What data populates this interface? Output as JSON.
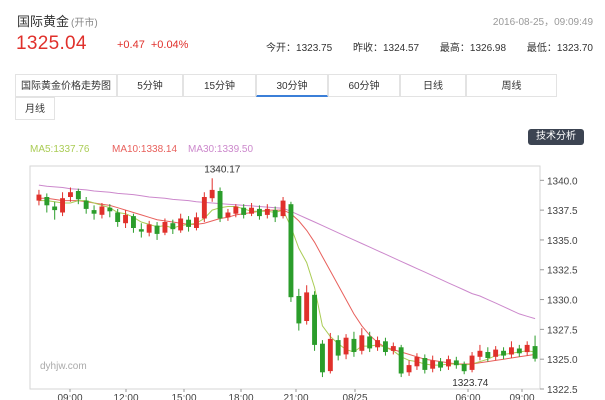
{
  "header": {
    "title": "国际黄金",
    "status": "(开市)",
    "datetime": "2016-08-25，09:09:49",
    "price": "1325.04",
    "change": "+0.47",
    "change_pct": "+0.04%",
    "stats": [
      {
        "label": "今开：",
        "value": "1323.75"
      },
      {
        "label": "昨收：",
        "value": "1324.57"
      },
      {
        "label": "最高：",
        "value": "1326.98"
      },
      {
        "label": "最低：",
        "value": "1323.70"
      }
    ]
  },
  "tabs": [
    "国际黄金价格走势图",
    "5分钟",
    "15分钟",
    "30分钟",
    "60分钟",
    "日线",
    "周线",
    "月线"
  ],
  "active_tab": "30分钟",
  "ma": {
    "ma5": "MA5:1337.76",
    "ma10": "MA10:1338.14",
    "ma30": "MA30:1339.50"
  },
  "colors": {
    "up": "#e0302b",
    "down": "#2b9d2b",
    "ma5": "#aacc55",
    "ma10": "#e8605c",
    "ma30": "#cc88cc"
  },
  "tech_button": "技术分析",
  "watermark": "dyhjw.com",
  "chart_data": {
    "type": "candlestick",
    "ylim": [
      1322.5,
      1341.2
    ],
    "yticks": [
      "1340.0",
      "1337.5",
      "1335.0",
      "1332.5",
      "1330.0",
      "1327.5",
      "1325.0",
      "1322.5"
    ],
    "xticks": [
      "09:00",
      "12:00",
      "15:00",
      "18:00",
      "21:00",
      "08/25",
      "06:00",
      "09:00"
    ],
    "annotations": [
      {
        "text": "1340.17",
        "index": 22
      },
      {
        "text": "1323.74",
        "index": 54
      }
    ],
    "candles": [
      {
        "o": 1338.3,
        "c": 1338.8,
        "h": 1339.2,
        "l": 1337.9
      },
      {
        "o": 1338.6,
        "c": 1337.9,
        "h": 1338.9,
        "l": 1337.3
      },
      {
        "o": 1337.8,
        "c": 1337.5,
        "h": 1338.2,
        "l": 1336.7
      },
      {
        "o": 1337.3,
        "c": 1338.5,
        "h": 1339.0,
        "l": 1337.0
      },
      {
        "o": 1338.6,
        "c": 1339.0,
        "h": 1339.4,
        "l": 1338.2
      },
      {
        "o": 1339.1,
        "c": 1338.4,
        "h": 1339.3,
        "l": 1338.0
      },
      {
        "o": 1338.3,
        "c": 1337.6,
        "h": 1338.6,
        "l": 1337.2
      },
      {
        "o": 1337.5,
        "c": 1337.2,
        "h": 1337.9,
        "l": 1336.7
      },
      {
        "o": 1337.1,
        "c": 1337.8,
        "h": 1338.1,
        "l": 1336.8
      },
      {
        "o": 1337.7,
        "c": 1337.4,
        "h": 1338.0,
        "l": 1336.9
      },
      {
        "o": 1337.3,
        "c": 1336.5,
        "h": 1337.6,
        "l": 1336.1
      },
      {
        "o": 1336.4,
        "c": 1337.1,
        "h": 1337.5,
        "l": 1336.0
      },
      {
        "o": 1337.0,
        "c": 1336.0,
        "h": 1337.2,
        "l": 1335.6
      },
      {
        "o": 1335.9,
        "c": 1335.7,
        "h": 1336.4,
        "l": 1335.2
      },
      {
        "o": 1335.6,
        "c": 1336.3,
        "h": 1336.6,
        "l": 1335.3
      },
      {
        "o": 1336.2,
        "c": 1335.5,
        "h": 1336.5,
        "l": 1335.0
      },
      {
        "o": 1335.6,
        "c": 1336.5,
        "h": 1336.8,
        "l": 1335.4
      },
      {
        "o": 1336.4,
        "c": 1335.9,
        "h": 1336.7,
        "l": 1335.5
      },
      {
        "o": 1335.8,
        "c": 1336.8,
        "h": 1337.2,
        "l": 1335.6
      },
      {
        "o": 1336.7,
        "c": 1336.1,
        "h": 1337.0,
        "l": 1335.7
      },
      {
        "o": 1336.0,
        "c": 1336.9,
        "h": 1337.3,
        "l": 1335.8
      },
      {
        "o": 1336.8,
        "c": 1338.6,
        "h": 1339.0,
        "l": 1336.5
      },
      {
        "o": 1338.5,
        "c": 1339.2,
        "h": 1340.17,
        "l": 1338.2
      },
      {
        "o": 1339.1,
        "c": 1336.8,
        "h": 1339.4,
        "l": 1336.5
      },
      {
        "o": 1336.9,
        "c": 1337.3,
        "h": 1337.6,
        "l": 1336.6
      },
      {
        "o": 1337.2,
        "c": 1337.8,
        "h": 1338.0,
        "l": 1336.9
      },
      {
        "o": 1337.7,
        "c": 1337.1,
        "h": 1338.0,
        "l": 1336.8
      },
      {
        "o": 1337.2,
        "c": 1337.7,
        "h": 1338.1,
        "l": 1337.0
      },
      {
        "o": 1337.6,
        "c": 1337.0,
        "h": 1337.9,
        "l": 1336.7
      },
      {
        "o": 1337.1,
        "c": 1337.6,
        "h": 1338.0,
        "l": 1336.8
      },
      {
        "o": 1337.5,
        "c": 1336.9,
        "h": 1337.8,
        "l": 1336.5
      },
      {
        "o": 1337.0,
        "c": 1338.3,
        "h": 1338.6,
        "l": 1336.8
      },
      {
        "o": 1338.0,
        "c": 1330.2,
        "h": 1338.2,
        "l": 1329.8
      },
      {
        "o": 1330.3,
        "c": 1328.0,
        "h": 1330.9,
        "l": 1327.4
      },
      {
        "o": 1328.2,
        "c": 1330.6,
        "h": 1331.2,
        "l": 1327.9
      },
      {
        "o": 1330.4,
        "c": 1326.2,
        "h": 1330.7,
        "l": 1325.7
      },
      {
        "o": 1326.3,
        "c": 1323.9,
        "h": 1326.6,
        "l": 1323.5
      },
      {
        "o": 1324.0,
        "c": 1326.7,
        "h": 1327.2,
        "l": 1323.8
      },
      {
        "o": 1326.6,
        "c": 1325.3,
        "h": 1327.0,
        "l": 1324.9
      },
      {
        "o": 1325.4,
        "c": 1326.8,
        "h": 1327.1,
        "l": 1325.0
      },
      {
        "o": 1326.7,
        "c": 1325.6,
        "h": 1327.3,
        "l": 1325.2
      },
      {
        "o": 1325.7,
        "c": 1327.0,
        "h": 1327.6,
        "l": 1325.4
      },
      {
        "o": 1326.9,
        "c": 1325.9,
        "h": 1327.3,
        "l": 1325.6
      },
      {
        "o": 1326.0,
        "c": 1326.6,
        "h": 1326.9,
        "l": 1325.7
      },
      {
        "o": 1326.5,
        "c": 1325.6,
        "h": 1326.8,
        "l": 1325.3
      },
      {
        "o": 1325.7,
        "c": 1326.1,
        "h": 1326.4,
        "l": 1325.4
      },
      {
        "o": 1326.0,
        "c": 1323.8,
        "h": 1326.2,
        "l": 1323.5
      },
      {
        "o": 1323.9,
        "c": 1324.5,
        "h": 1324.9,
        "l": 1323.6
      },
      {
        "o": 1324.4,
        "c": 1325.2,
        "h": 1325.5,
        "l": 1324.1
      },
      {
        "o": 1325.1,
        "c": 1324.1,
        "h": 1325.4,
        "l": 1323.8
      },
      {
        "o": 1324.2,
        "c": 1324.9,
        "h": 1325.3,
        "l": 1323.9
      },
      {
        "o": 1324.8,
        "c": 1324.3,
        "h": 1325.1,
        "l": 1324.0
      },
      {
        "o": 1324.4,
        "c": 1325.0,
        "h": 1325.3,
        "l": 1324.1
      },
      {
        "o": 1324.9,
        "c": 1324.5,
        "h": 1325.2,
        "l": 1324.2
      },
      {
        "o": 1324.6,
        "c": 1324.0,
        "h": 1324.8,
        "l": 1323.74
      },
      {
        "o": 1324.1,
        "c": 1325.3,
        "h": 1325.6,
        "l": 1323.9
      },
      {
        "o": 1325.2,
        "c": 1325.7,
        "h": 1326.2,
        "l": 1324.9
      },
      {
        "o": 1325.6,
        "c": 1325.1,
        "h": 1326.0,
        "l": 1324.8
      },
      {
        "o": 1325.2,
        "c": 1325.8,
        "h": 1326.1,
        "l": 1324.9
      },
      {
        "o": 1325.7,
        "c": 1325.3,
        "h": 1326.0,
        "l": 1325.0
      },
      {
        "o": 1325.4,
        "c": 1326.0,
        "h": 1326.5,
        "l": 1325.1
      },
      {
        "o": 1325.9,
        "c": 1325.5,
        "h": 1326.2,
        "l": 1325.2
      },
      {
        "o": 1325.6,
        "c": 1326.2,
        "h": 1326.5,
        "l": 1325.3
      },
      {
        "o": 1326.1,
        "c": 1325.04,
        "h": 1326.98,
        "l": 1324.8
      }
    ],
    "ma5": [
      1338.3,
      1338.3,
      1338.2,
      1338.1,
      1338.1,
      1338.3,
      1338.3,
      1338.1,
      1337.9,
      1337.7,
      1337.3,
      1337.2,
      1336.9,
      1336.5,
      1336.3,
      1336.1,
      1336.2,
      1336.0,
      1336.2,
      1336.3,
      1336.4,
      1336.8,
      1337.5,
      1337.7,
      1337.8,
      1337.8,
      1337.6,
      1337.4,
      1337.4,
      1337.4,
      1337.3,
      1337.5,
      1336.1,
      1334.3,
      1333.1,
      1331.0,
      1327.8,
      1326.9,
      1326.3,
      1325.8,
      1325.6,
      1326.1,
      1326.1,
      1326.2,
      1326.0,
      1325.7,
      1325.2,
      1324.9,
      1324.8,
      1324.6,
      1324.5,
      1324.5,
      1324.6,
      1324.6,
      1324.5,
      1324.6,
      1324.8,
      1325.0,
      1325.3,
      1325.4,
      1325.5,
      1325.6,
      1325.7,
      1325.6
    ],
    "ma10": [
      1338.5,
      1338.5,
      1338.4,
      1338.3,
      1338.3,
      1338.3,
      1338.2,
      1338.1,
      1338.0,
      1337.9,
      1337.7,
      1337.5,
      1337.3,
      1337.1,
      1336.9,
      1336.7,
      1336.6,
      1336.5,
      1336.4,
      1336.3,
      1336.3,
      1336.4,
      1336.6,
      1336.8,
      1336.9,
      1337.1,
      1337.2,
      1337.3,
      1337.4,
      1337.5,
      1337.5,
      1337.5,
      1337.2,
      1336.6,
      1335.8,
      1334.8,
      1333.6,
      1332.4,
      1331.2,
      1330.0,
      1328.8,
      1327.8,
      1327.0,
      1326.4,
      1326.0,
      1325.8,
      1325.6,
      1325.4,
      1325.2,
      1325.0,
      1324.9,
      1324.8,
      1324.7,
      1324.6,
      1324.6,
      1324.6,
      1324.7,
      1324.8,
      1324.9,
      1325.0,
      1325.1,
      1325.2,
      1325.3,
      1325.4
    ],
    "ma30": [
      1339.6,
      1339.5,
      1339.45,
      1339.4,
      1339.3,
      1339.25,
      1339.2,
      1339.1,
      1339.05,
      1339.0,
      1338.9,
      1338.85,
      1338.8,
      1338.7,
      1338.6,
      1338.55,
      1338.5,
      1338.4,
      1338.35,
      1338.3,
      1338.2,
      1338.15,
      1338.1,
      1338.05,
      1338.0,
      1337.95,
      1337.9,
      1337.85,
      1337.8,
      1337.75,
      1337.7,
      1337.65,
      1337.4,
      1337.1,
      1336.8,
      1336.5,
      1336.2,
      1335.9,
      1335.6,
      1335.3,
      1335.0,
      1334.7,
      1334.4,
      1334.1,
      1333.8,
      1333.5,
      1333.2,
      1332.9,
      1332.6,
      1332.3,
      1332.0,
      1331.7,
      1331.4,
      1331.1,
      1330.8,
      1330.5,
      1330.3,
      1330.0,
      1329.7,
      1329.4,
      1329.1,
      1328.8,
      1328.6,
      1328.4
    ]
  }
}
